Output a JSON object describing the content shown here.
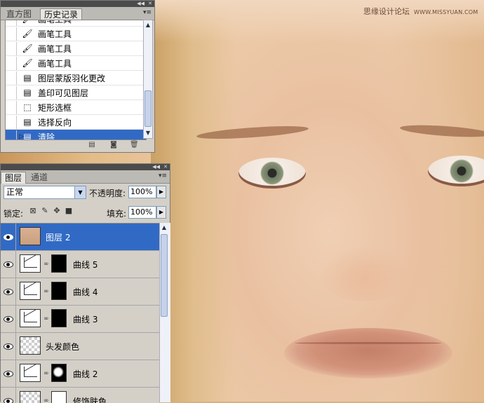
{
  "watermark": {
    "cn": "思缘设计论坛",
    "url": "WWW.MISSYUAN.COM"
  },
  "history_panel": {
    "tabs": [
      {
        "label": "直方图",
        "active": false
      },
      {
        "label": "历史记录",
        "active": true
      }
    ],
    "items": [
      {
        "label": "画笔工具",
        "icon": "brush-icon",
        "selected": false
      },
      {
        "label": "画笔工具",
        "icon": "brush-icon",
        "selected": false
      },
      {
        "label": "画笔工具",
        "icon": "brush-icon",
        "selected": false
      },
      {
        "label": "画笔工具",
        "icon": "brush-icon",
        "selected": false
      },
      {
        "label": "图层蒙版羽化更改",
        "icon": "document-icon",
        "selected": false
      },
      {
        "label": "盖印可见图层",
        "icon": "document-icon",
        "selected": false
      },
      {
        "label": "矩形选框",
        "icon": "marquee-icon",
        "selected": false
      },
      {
        "label": "选择反向",
        "icon": "document-icon",
        "selected": false
      },
      {
        "label": "清除",
        "icon": "document-icon",
        "selected": true
      }
    ],
    "footer_icons": [
      "new-document-icon",
      "camera-icon",
      "trash-icon"
    ]
  },
  "layers_panel": {
    "tabs": [
      {
        "label": "图层",
        "active": true
      },
      {
        "label": "通道",
        "active": false
      }
    ],
    "blend_mode": "正常",
    "opacity_label": "不透明度:",
    "opacity_value": "100%",
    "lock_label": "锁定:",
    "fill_label": "填充:",
    "fill_value": "100%",
    "layers": [
      {
        "name": "图层 2",
        "type": "pixel-eyes",
        "selected": true,
        "mask": null
      },
      {
        "name": "曲线 5",
        "type": "curves",
        "selected": false,
        "mask": "black"
      },
      {
        "name": "曲线 4",
        "type": "curves",
        "selected": false,
        "mask": "black"
      },
      {
        "name": "曲线 3",
        "type": "curves",
        "selected": false,
        "mask": "black"
      },
      {
        "name": "头发颜色",
        "type": "checker",
        "selected": false,
        "mask": null
      },
      {
        "name": "曲线 2",
        "type": "curves",
        "selected": false,
        "mask": "black-white-blob"
      },
      {
        "name": "修饰肤色",
        "type": "checker",
        "selected": false,
        "mask": "white"
      }
    ]
  }
}
